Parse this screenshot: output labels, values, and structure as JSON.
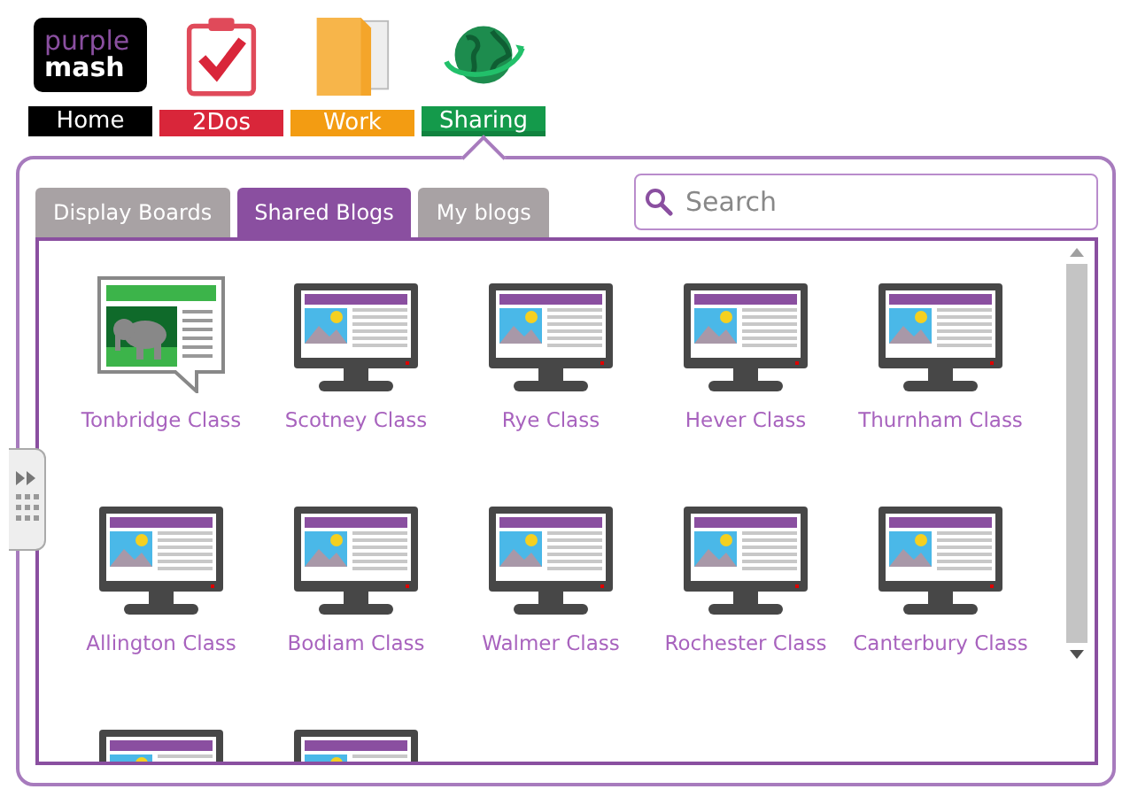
{
  "nav": [
    {
      "label": "Home",
      "color": "#000000",
      "kind": "logo",
      "logo_lines": [
        "purple",
        "mash"
      ]
    },
    {
      "label": "2Dos",
      "color": "#d9263a",
      "kind": "clipboard"
    },
    {
      "label": "Work",
      "color": "#f39c12",
      "kind": "folder"
    },
    {
      "label": "Sharing",
      "color": "#149a4b",
      "kind": "globe",
      "selected": true
    }
  ],
  "tabs": [
    {
      "label": "Display Boards",
      "selected": false
    },
    {
      "label": "Shared Blogs",
      "selected": true
    },
    {
      "label": "My blogs",
      "selected": false
    }
  ],
  "search": {
    "placeholder": "Search"
  },
  "items": [
    {
      "kind": "board",
      "label": "Tonbridge Class"
    },
    {
      "kind": "monitor",
      "label": "Scotney Class"
    },
    {
      "kind": "monitor",
      "label": "Rye Class"
    },
    {
      "kind": "monitor",
      "label": "Hever Class"
    },
    {
      "kind": "monitor",
      "label": "Thurnham Class"
    },
    {
      "kind": "monitor",
      "label": "Allington Class"
    },
    {
      "kind": "monitor",
      "label": "Bodiam Class"
    },
    {
      "kind": "monitor",
      "label": "Walmer Class"
    },
    {
      "kind": "monitor",
      "label": "Rochester Class"
    },
    {
      "kind": "monitor",
      "label": "Canterbury Class"
    },
    {
      "kind": "monitor"
    },
    {
      "kind": "monitor"
    }
  ]
}
